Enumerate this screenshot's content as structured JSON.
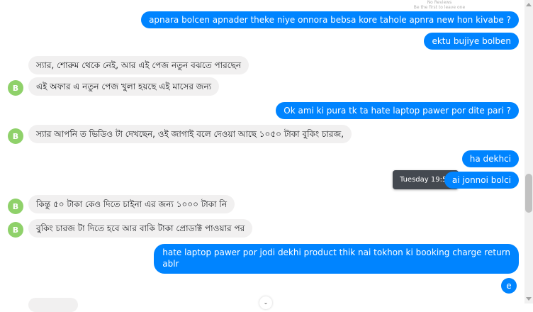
{
  "top_note": {
    "line1": "No Reviews",
    "line2": "Be the first to leave one"
  },
  "messages": [
    {
      "side": "out",
      "text": "apnara bolcen apnader theke niye onnora bebsa kore tahole apnra new hon kivabe ?"
    },
    {
      "side": "out",
      "text": "ektu bujiye bolben"
    },
    {
      "side": "in",
      "text": "স্যার, শোরুম থেকে নেই, আর এই পেজ নতুন বঝতে পারছেন"
    },
    {
      "side": "in",
      "text": "এই অফার এ নতুন পেজ খুলা হয়ছে এই মাসের জন্য",
      "avatar": "B"
    },
    {
      "side": "out",
      "text": "Ok ami ki pura tk ta hate laptop pawer por dite pari ?"
    },
    {
      "side": "in",
      "text": "স্যার আপনি ত ভিডিও টা দেখছেন, ওই জাগাই বলে দেওয়া আছে ১০৫০ টাকা বুকিং চারজ,",
      "avatar": "B"
    },
    {
      "side": "out",
      "text": "ha dekhci"
    },
    {
      "side": "out",
      "text": "ai jonnoi bolci"
    },
    {
      "side": "in",
      "text": "কিন্তু ৫০ টাকা কেও দিতে চাইনা এর জন্য ১০০০ টাকা নি",
      "avatar": "B"
    },
    {
      "side": "in",
      "text": "বুকিং চারজ টা দিতে হবে আর বাকি টাকা প্রোডাক্ট পাওয়ার পর",
      "avatar": "B"
    },
    {
      "side": "out",
      "text_line1": "hate laptop pawer por jodi dekhi product thik nai tokhon ki booking charge return",
      "text_line2": "ablr"
    },
    {
      "side": "out",
      "text": "e"
    }
  ],
  "tooltip": {
    "text": "Tuesday 19:56"
  },
  "colors": {
    "outgoing": "#0084ff",
    "incoming": "#f1f0f0",
    "avatar": "#8fd16a",
    "tooltip": "#444950"
  }
}
